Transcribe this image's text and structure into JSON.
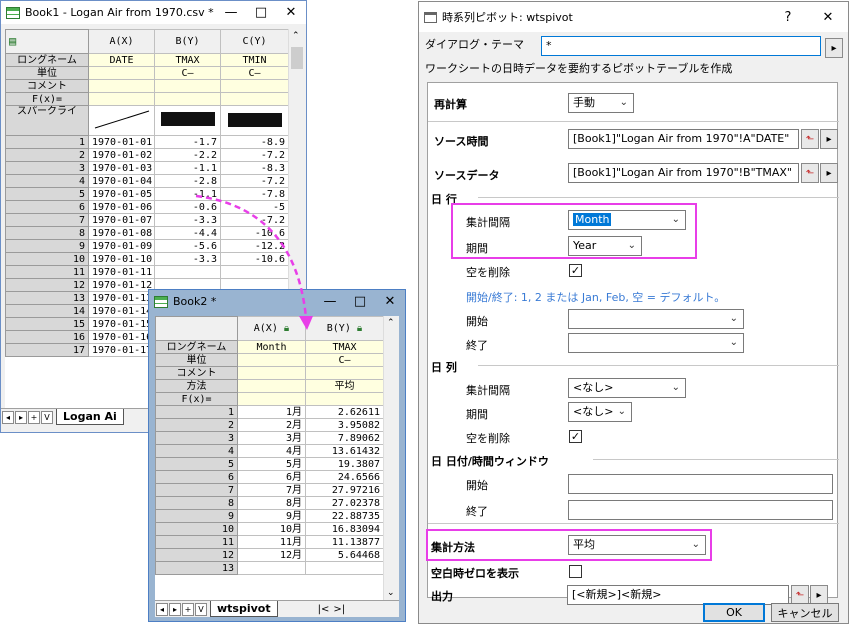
{
  "book1": {
    "title": "Book1 - Logan Air from 1970.csv *",
    "minimize": "—",
    "maximize": "□",
    "close": "✕",
    "columns": [
      "A(X)",
      "B(Y)",
      "C(Y)"
    ],
    "meta_labels": [
      "ロングネーム",
      "単位",
      "コメント",
      "F(x)=",
      "スパークライ"
    ],
    "long_names": [
      "DATE",
      "TMAX",
      "TMIN"
    ],
    "units": [
      "",
      "C—",
      "C—"
    ],
    "rows": [
      [
        "1",
        "1970-01-01",
        "-1.7",
        "-8.9"
      ],
      [
        "2",
        "1970-01-02",
        "-2.2",
        "-7.2"
      ],
      [
        "3",
        "1970-01-03",
        "-1.1",
        "-8.3"
      ],
      [
        "4",
        "1970-01-04",
        "-2.8",
        "-7.2"
      ],
      [
        "5",
        "1970-01-05",
        "-1.1",
        "-7.8"
      ],
      [
        "6",
        "1970-01-06",
        "-0.6",
        "-5"
      ],
      [
        "7",
        "1970-01-07",
        "-3.3",
        "-7.2"
      ],
      [
        "8",
        "1970-01-08",
        "-4.4",
        "-10.6"
      ],
      [
        "9",
        "1970-01-09",
        "-5.6",
        "-12.2"
      ],
      [
        "10",
        "1970-01-10",
        "-3.3",
        "-10.6"
      ],
      [
        "11",
        "1970-01-11",
        "",
        ""
      ],
      [
        "12",
        "1970-01-12",
        "",
        ""
      ],
      [
        "13",
        "1970-01-13",
        "",
        ""
      ],
      [
        "14",
        "1970-01-14",
        "",
        ""
      ],
      [
        "15",
        "1970-01-15",
        "",
        ""
      ],
      [
        "16",
        "1970-01-16",
        "",
        ""
      ],
      [
        "17",
        "1970-01-17",
        "",
        ""
      ]
    ],
    "tab_nav": [
      "◂",
      "▸",
      "+",
      "V"
    ],
    "sheet_tab": "Logan Ai"
  },
  "book2": {
    "title": "Book2 *",
    "minimize": "—",
    "maximize": "□",
    "close": "✕",
    "columns": [
      "A(X)",
      "B(Y)"
    ],
    "meta_labels": [
      "ロングネーム",
      "単位",
      "コメント",
      "方法",
      "F(x)="
    ],
    "long_names": [
      "Month",
      "TMAX"
    ],
    "units": [
      "",
      "C—"
    ],
    "method": [
      "",
      "平均"
    ],
    "rows": [
      [
        "1",
        "1月",
        "2.62611"
      ],
      [
        "2",
        "2月",
        "3.95082"
      ],
      [
        "3",
        "3月",
        "7.89062"
      ],
      [
        "4",
        "4月",
        "13.61432"
      ],
      [
        "5",
        "5月",
        "19.3807"
      ],
      [
        "6",
        "6月",
        "24.6566"
      ],
      [
        "7",
        "7月",
        "27.97216"
      ],
      [
        "8",
        "8月",
        "27.02378"
      ],
      [
        "9",
        "9月",
        "22.88735"
      ],
      [
        "10",
        "10月",
        "16.83094"
      ],
      [
        "11",
        "11月",
        "11.13877"
      ],
      [
        "12",
        "12月",
        "5.64468"
      ],
      [
        "13",
        "",
        ""
      ]
    ],
    "tab_nav": [
      "◂",
      "▸",
      "+",
      "V"
    ],
    "sheet_tab": "wtspivot"
  },
  "dialog": {
    "title": "時系列ピボット: wtspivot",
    "help": "?",
    "close": "✕",
    "theme_label": "ダイアログ・テーマ",
    "theme_value": "*",
    "description": "ワークシートの日時データを要約するピボットテーブルを作成",
    "recalc_label": "再計算",
    "recalc_value": "手動",
    "source_time_label": "ソース時間",
    "source_time_value": "[Book1]\"Logan Air from 1970\"!A\"DATE\"",
    "source_data_label": "ソースデータ",
    "source_data_value": "[Book1]\"Logan Air from 1970\"!B\"TMAX\"",
    "rows_section": "日 行",
    "interval_label": "集計間隔",
    "rows_interval_value": "Month",
    "period_label": "期間",
    "rows_period_value": "Year",
    "remove_empty_label": "空を削除",
    "hint": "開始/終了: 1, 2 または Jan, Feb, 空 = デフォルト。",
    "start_label": "開始",
    "end_label": "終了",
    "cols_section": "日 列",
    "cols_interval_value": "<なし>",
    "cols_period_value": "<なし>",
    "window_section": "日 日付/時間ウィンドウ",
    "method_label": "集計方法",
    "method_value": "平均",
    "show_zero_label": "空白時ゼロを表示",
    "output_label": "出力",
    "output_value": "[<新規>]<新規>",
    "ok": "OK",
    "cancel": "キャンセル",
    "checkmark": "✓"
  },
  "colors": {
    "highlight": "#e83ee8",
    "arrow": "#e83ee8",
    "hint": "#3a7bd5"
  }
}
